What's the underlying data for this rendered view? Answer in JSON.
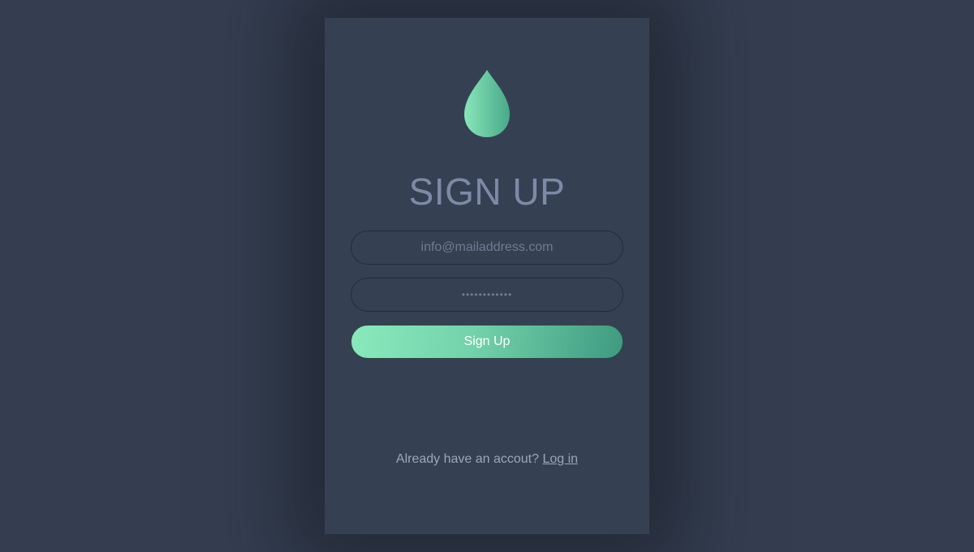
{
  "form": {
    "title": "SIGN UP",
    "email_placeholder": "info@mailaddress.com",
    "password_placeholder": "••••••••••••",
    "submit_label": "Sign Up"
  },
  "footer": {
    "prompt": "Already have an accout?",
    "login_link": "Log in"
  },
  "logo": {
    "icon": "water-drop-icon",
    "gradient_start": "#88e6ba",
    "gradient_end": "#49a888"
  },
  "colors": {
    "background": "#343e50",
    "card": "#364053",
    "accent": "#73d2ab"
  }
}
